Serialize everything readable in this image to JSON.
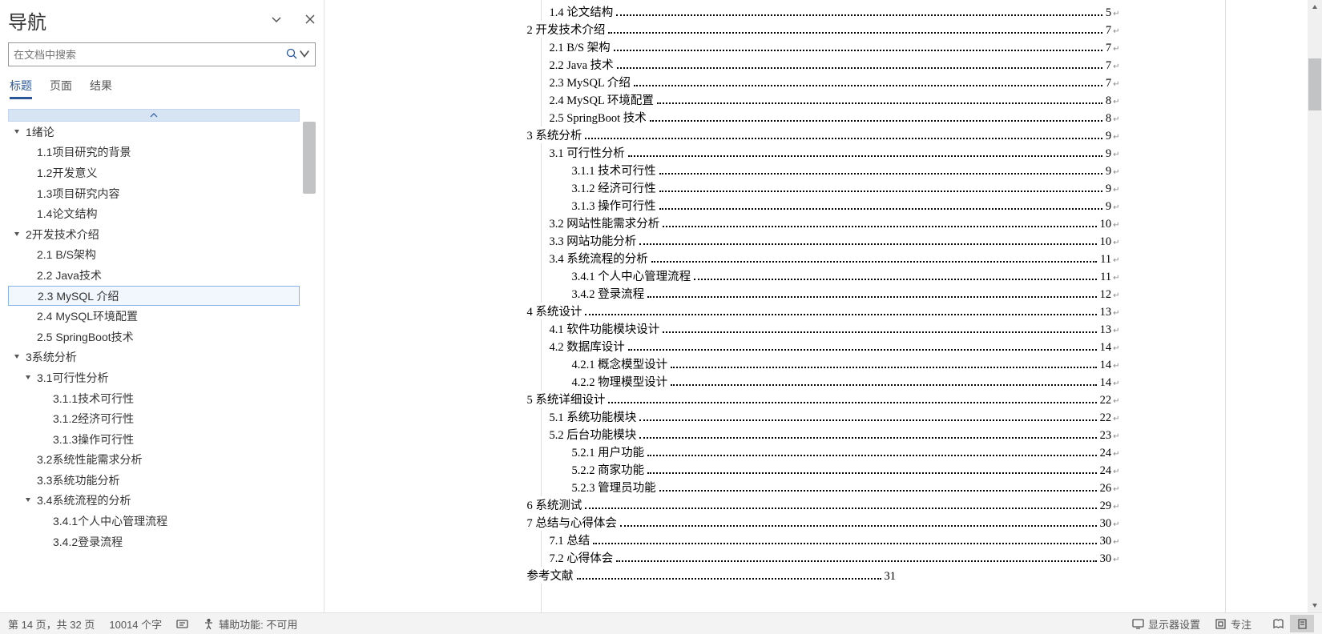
{
  "nav": {
    "title": "导航",
    "search_placeholder": "在文档中搜索",
    "tabs": {
      "headings": "标题",
      "pages": "页面",
      "results": "结果"
    },
    "outline": [
      {
        "level": 0,
        "expand": true,
        "label": "1绪论"
      },
      {
        "level": 1,
        "label": "1.1项目研究的背景"
      },
      {
        "level": 1,
        "label": "1.2开发意义"
      },
      {
        "level": 1,
        "label": "1.3项目研究内容"
      },
      {
        "level": 1,
        "label": "1.4论文结构"
      },
      {
        "level": 0,
        "expand": true,
        "label": "2开发技术介绍"
      },
      {
        "level": 1,
        "label": "2.1 B/S架构"
      },
      {
        "level": 1,
        "label": "2.2 Java技术"
      },
      {
        "level": 1,
        "label": "2.3 MySQL 介绍",
        "selected": true
      },
      {
        "level": 1,
        "label": "2.4 MySQL环境配置"
      },
      {
        "level": 1,
        "label": "2.5 SpringBoot技术"
      },
      {
        "level": 0,
        "expand": true,
        "label": "3系统分析"
      },
      {
        "level": 1,
        "expand": true,
        "pad0h": true,
        "label": "3.1可行性分析"
      },
      {
        "level": 2,
        "label": "3.1.1技术可行性"
      },
      {
        "level": 2,
        "label": "3.1.2经济可行性"
      },
      {
        "level": 2,
        "label": "3.1.3操作可行性"
      },
      {
        "level": 1,
        "label": "3.2系统性能需求分析"
      },
      {
        "level": 1,
        "label": "3.3系统功能分析"
      },
      {
        "level": 1,
        "expand": true,
        "pad0h": true,
        "label": "3.4系统流程的分析"
      },
      {
        "level": 2,
        "label": "3.4.1个人中心管理流程"
      },
      {
        "level": 2,
        "label": "3.4.2登录流程"
      }
    ]
  },
  "toc": [
    {
      "level": 1,
      "text": "1.4 论文结构",
      "page": "5"
    },
    {
      "level": 0,
      "text": "2 开发技术介绍",
      "page": "7"
    },
    {
      "level": 1,
      "text": "2.1 B/S 架构",
      "page": "7"
    },
    {
      "level": 1,
      "text": "2.2 Java 技术",
      "page": "7"
    },
    {
      "level": 1,
      "text": "2.3 MySQL  介绍",
      "page": "7"
    },
    {
      "level": 1,
      "text": "2.4 MySQL 环境配置",
      "page": "8"
    },
    {
      "level": 1,
      "text": "2.5 SpringBoot 技术",
      "page": "8"
    },
    {
      "level": 0,
      "text": "3 系统分析",
      "page": "9"
    },
    {
      "level": 1,
      "text": "3.1 可行性分析",
      "page": "9"
    },
    {
      "level": 2,
      "text": "3.1.1 技术可行性",
      "page": "9"
    },
    {
      "level": 2,
      "text": "3.1.2 经济可行性",
      "page": "9"
    },
    {
      "level": 2,
      "text": "3.1.3 操作可行性",
      "page": "9"
    },
    {
      "level": 1,
      "text": "3.2 网站性能需求分析",
      "page": "10"
    },
    {
      "level": 1,
      "text": "3.3 网站功能分析",
      "page": "10"
    },
    {
      "level": 1,
      "text": "3.4 系统流程的分析",
      "page": "11"
    },
    {
      "level": 2,
      "text": "3.4.1 个人中心管理流程",
      "page": "11"
    },
    {
      "level": 2,
      "text": "3.4.2 登录流程",
      "page": "12"
    },
    {
      "level": 0,
      "text": "4 系统设计",
      "page": "13"
    },
    {
      "level": 1,
      "text": "4.1  软件功能模块设计",
      "page": "13"
    },
    {
      "level": 1,
      "text": "4.2 数据库设计",
      "page": "14"
    },
    {
      "level": 2,
      "text": "4.2.1  概念模型设计",
      "page": "14"
    },
    {
      "level": 2,
      "text": "4.2.2  物理模型设计",
      "page": "14"
    },
    {
      "level": 0,
      "text": "5 系统详细设计",
      "page": "22"
    },
    {
      "level": 1,
      "text": "5.1 系统功能模块",
      "page": "22"
    },
    {
      "level": 1,
      "text": "5.2 后台功能模块",
      "page": "23"
    },
    {
      "level": 2,
      "text": "5.2.1 用户功能",
      "page": "24"
    },
    {
      "level": 2,
      "text": "5.2.2 商家功能",
      "page": "24"
    },
    {
      "level": 2,
      "text": "5.2.3 管理员功能",
      "page": "26"
    },
    {
      "level": 0,
      "text": "6 系统测试",
      "page": "29"
    },
    {
      "level": 0,
      "text": "7 总结与心得体会",
      "page": "30"
    },
    {
      "level": 1,
      "text": "7.1  总结",
      "page": "30"
    },
    {
      "level": 1,
      "text": "7.2  心得体会",
      "page": "30"
    },
    {
      "level": 0,
      "text": "参考文献",
      "page": "31",
      "nodots": true
    }
  ],
  "status": {
    "page_info": "第 14 页，共 32 页",
    "word_count": "10014 个字",
    "accessibility": "辅助功能: 不可用",
    "display_settings": "显示器设置",
    "focus": "专注"
  }
}
